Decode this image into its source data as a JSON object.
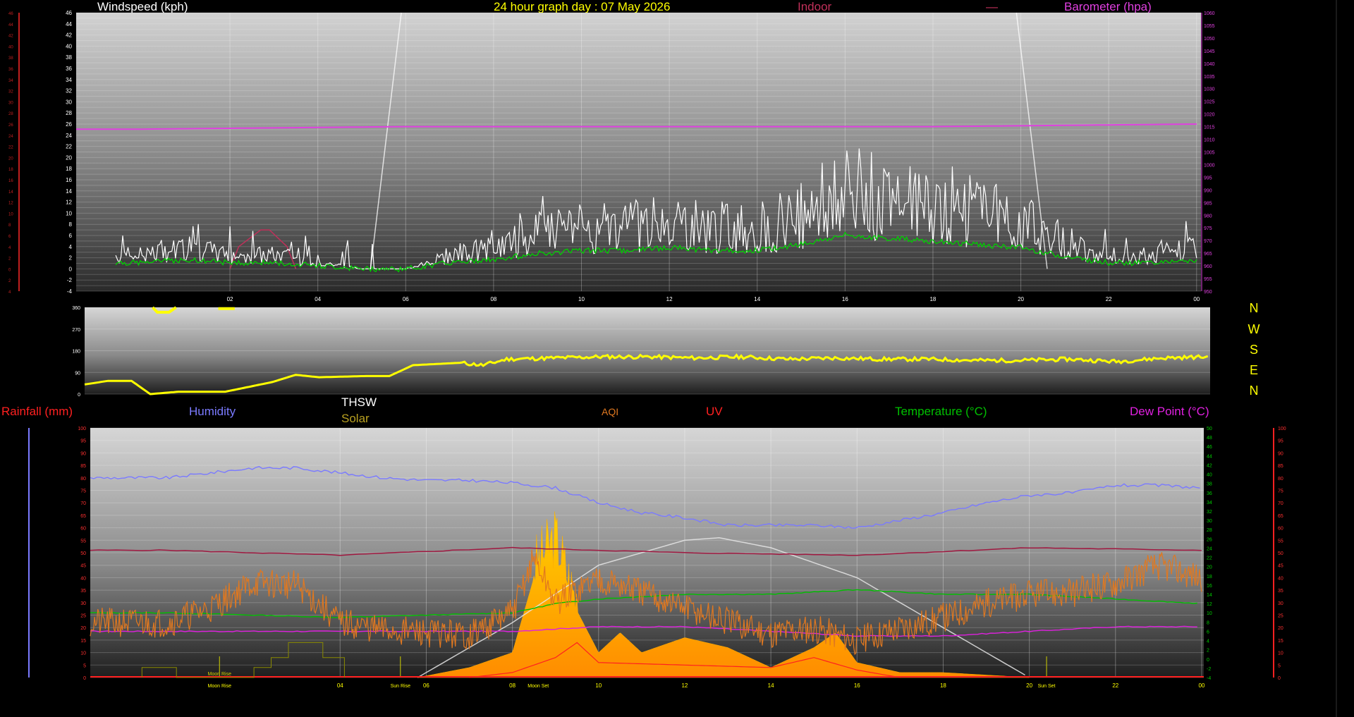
{
  "header": {
    "windspeed_title": "Windspeed (kph)",
    "graph_title": "24 hour graph day : 07 May 2026",
    "indoor_label": "Indoor",
    "indoor_dash": "—",
    "barometer_title": "Barometer (hpa)"
  },
  "legend": {
    "rainfall": "Rainfall (mm)",
    "humidity": "Humidity",
    "thsw": "THSW",
    "solar": "Solar",
    "aqi": "AQI",
    "uv": "UV",
    "temperature": "Temperature (°C)",
    "dewpoint": "Dew Point (°C)"
  },
  "compass": [
    "N",
    "W",
    "S",
    "E",
    "N"
  ],
  "colors": {
    "wind": "#ffffff",
    "gust_avg": "#00d000",
    "barometer": "#e040e0",
    "indoor": "#c0305a",
    "direction": "#ffff00",
    "humidity": "#7a7aff",
    "thsw": "#ffffff",
    "solar": "#ffc000",
    "aqi": "#e07820",
    "uv": "#ff2020",
    "temperature": "#00c000",
    "dewpoint": "#e020e0",
    "rainfall": "#ff2020",
    "indoor_humidity": "#a01840"
  },
  "chart_data": [
    {
      "type": "line",
      "title": "Windspeed (kph)",
      "xlabel": "",
      "ylabel": "Windspeed (kph)",
      "x_ticks": [
        "02",
        "04",
        "06",
        "08",
        "10",
        "12",
        "14",
        "16",
        "18",
        "20",
        "22",
        "00"
      ],
      "xlim_hours": [
        0,
        24
      ],
      "ylim": [
        -4,
        46
      ],
      "y_ticks": [
        -4,
        -2,
        0,
        2,
        4,
        6,
        8,
        10,
        12,
        14,
        16,
        18,
        20,
        22,
        24,
        26,
        28,
        30,
        32,
        34,
        36,
        38,
        40,
        42,
        44,
        46
      ],
      "y2_label": "Barometer (hpa)",
      "y2lim": [
        950,
        1060
      ],
      "y2_ticks": [
        950,
        955,
        960,
        965,
        970,
        975,
        980,
        985,
        990,
        995,
        1000,
        1005,
        1010,
        1015,
        1020,
        1025,
        1030,
        1035,
        1040,
        1045,
        1050,
        1055,
        1060
      ],
      "series": [
        {
          "name": "Windspeed (kph)",
          "hours": [
            0,
            1,
            2,
            3,
            4,
            5,
            6,
            7,
            8,
            9,
            10,
            11,
            12,
            13,
            14,
            15,
            16,
            17,
            18,
            19,
            20,
            21,
            22,
            23,
            24
          ],
          "values": [
            2,
            3,
            2,
            2,
            1,
            0,
            0,
            2,
            3,
            5,
            6,
            6,
            7,
            6,
            6,
            8,
            11,
            10,
            9,
            8,
            7,
            4,
            2,
            2,
            3
          ]
        },
        {
          "name": "Barometer (hpa)",
          "hours": [
            0,
            6,
            12,
            18,
            24
          ],
          "values": [
            1014,
            1015,
            1015,
            1015,
            1016
          ]
        },
        {
          "name": "Indoor",
          "hours": [
            2,
            2.2,
            2.7,
            2.9,
            3.3,
            3.5
          ],
          "values": [
            0,
            4,
            7,
            7,
            4,
            0
          ]
        }
      ]
    },
    {
      "type": "line",
      "title": "Wind direction",
      "ylim": [
        0,
        360
      ],
      "y_ticks": [
        0,
        90,
        180,
        270,
        360
      ],
      "xlim_hours": [
        0,
        24
      ],
      "series": [
        {
          "name": "Direction",
          "hours": [
            0,
            0.5,
            1,
            1.4,
            2,
            3,
            3.5,
            4,
            4.5,
            5,
            6,
            6.5,
            7,
            7.5,
            8,
            8.5,
            9,
            10,
            11,
            12,
            13,
            14,
            15,
            16,
            17,
            18,
            19,
            20,
            21,
            22,
            23,
            24
          ],
          "values": [
            40,
            55,
            55,
            0,
            10,
            10,
            30,
            50,
            80,
            70,
            75,
            75,
            120,
            125,
            130,
            120,
            145,
            150,
            155,
            155,
            150,
            155,
            145,
            150,
            145,
            145,
            140,
            140,
            145,
            135,
            150,
            155
          ]
        }
      ]
    },
    {
      "type": "area",
      "title": "",
      "xlim_hours": [
        0,
        24
      ],
      "x_ticks": [
        "04",
        "06",
        "08",
        "10",
        "12",
        "14",
        "16",
        "18",
        "20",
        "22",
        "00"
      ],
      "events": [
        "Moon Rise",
        "Sun Rise",
        "Moon Set",
        "Sun Set"
      ],
      "ylim_humidity": [
        0,
        100
      ],
      "y_ticks_humidity": [
        0,
        5,
        10,
        15,
        20,
        25,
        30,
        35,
        40,
        45,
        50,
        55,
        60,
        65,
        70,
        75,
        80,
        85,
        90,
        95,
        100
      ],
      "ylim_temperature": [
        -4,
        50
      ],
      "y_ticks_temperature": [
        -4,
        -2,
        0,
        2,
        4,
        6,
        8,
        10,
        12,
        14,
        16,
        18,
        20,
        22,
        24,
        26,
        28,
        30,
        32,
        34,
        36,
        38,
        40,
        42,
        44,
        46,
        48,
        50
      ],
      "series": [
        {
          "name": "Humidity",
          "hours": [
            0,
            1,
            2,
            3,
            4,
            5,
            6,
            7,
            8,
            9,
            10,
            11,
            12,
            13,
            14,
            15,
            16,
            17,
            18,
            19,
            20,
            21,
            22,
            23,
            24
          ],
          "values": [
            80,
            82,
            84,
            84,
            82,
            80,
            79,
            79,
            78,
            76,
            70,
            66,
            64,
            61,
            61,
            61,
            60,
            63,
            66,
            70,
            73,
            74,
            77,
            77,
            76
          ]
        },
        {
          "name": "Temperature (°C)",
          "hours": [
            0,
            4,
            8,
            9,
            10,
            12,
            14,
            16,
            18,
            20,
            22,
            24
          ],
          "values": [
            10,
            9,
            10,
            12,
            13,
            14,
            14,
            15,
            14,
            14,
            13,
            12
          ]
        },
        {
          "name": "Dew Point (°C)",
          "hours": [
            0,
            4,
            8,
            10,
            12,
            14,
            16,
            18,
            20,
            22,
            24
          ],
          "values": [
            6,
            6,
            6,
            7,
            7,
            6,
            5,
            5,
            6,
            7,
            7
          ]
        },
        {
          "name": "AQI",
          "hours": [
            0,
            1,
            2,
            3,
            4,
            5,
            6,
            7,
            8,
            8.5,
            9,
            10,
            11,
            12,
            13,
            14,
            15,
            16,
            17,
            18,
            19,
            20,
            21,
            22,
            23,
            24
          ],
          "values": [
            22,
            28,
            38,
            37,
            22,
            19,
            18,
            17,
            26,
            48,
            30,
            40,
            34,
            28,
            22,
            18,
            20,
            15,
            20,
            24,
            30,
            33,
            34,
            38,
            45,
            40
          ]
        },
        {
          "name": "Solar",
          "hours": [
            5.8,
            7,
            8,
            8.5,
            9,
            9.4,
            10,
            10.5,
            11,
            12,
            13,
            14,
            15,
            15.5,
            16,
            17,
            18,
            19,
            20
          ],
          "values": [
            0,
            4,
            10,
            40,
            52,
            30,
            10,
            18,
            10,
            16,
            12,
            4,
            12,
            18,
            6,
            2,
            2,
            1,
            0
          ]
        },
        {
          "name": "THSW",
          "hours": [
            5.8,
            8,
            10,
            12,
            12.8,
            14,
            16,
            18,
            20
          ],
          "values": [
            0,
            22,
            45,
            55,
            56,
            52,
            40,
            20,
            0
          ]
        },
        {
          "name": "UV",
          "hours": [
            7,
            8,
            9,
            9.5,
            10,
            12,
            14,
            15,
            16,
            17
          ],
          "values": [
            0,
            2,
            8,
            14,
            6,
            5,
            4,
            8,
            3,
            0
          ]
        },
        {
          "name": "Indoor humidity",
          "hours": [
            0,
            4,
            8,
            12,
            16,
            20,
            24
          ],
          "values": [
            51,
            49,
            52,
            50,
            49,
            52,
            51
          ]
        },
        {
          "name": "Rainfall (mm)",
          "hours": [
            0,
            24
          ],
          "values": [
            0,
            0
          ]
        }
      ]
    }
  ]
}
